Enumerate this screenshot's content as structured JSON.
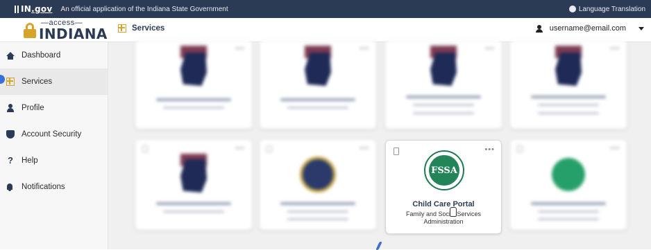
{
  "govbar": {
    "logo_prefix": "IN",
    "logo_suffix": ".gov",
    "text": "An official application of the Indiana State Government",
    "language": "Language Translation"
  },
  "header": {
    "logo_top": "—access—",
    "logo_main": "INDIANA",
    "page_title": "Services",
    "user_email": "username@email.com"
  },
  "sidebar": {
    "items": [
      {
        "label": "Dashboard",
        "icon": "home-icon"
      },
      {
        "label": "Services",
        "icon": "grid-icon"
      },
      {
        "label": "Profile",
        "icon": "person-icon"
      },
      {
        "label": "Account Security",
        "icon": "shield-icon"
      },
      {
        "label": "Help",
        "icon": "question-icon"
      },
      {
        "label": "Notifications",
        "icon": "bell-icon"
      }
    ],
    "active_index": 1
  },
  "cards": {
    "featured": {
      "title": "Child Care Portal",
      "subtitle": "Family and Social Services Administration",
      "logo_text": "FSSA",
      "menu": "•••"
    }
  },
  "colors": {
    "gov_bar": "#2b3a55",
    "accent_gold": "#d6a32b",
    "fssa_green": "#23845a",
    "active_indicator": "#3a6fd8"
  }
}
